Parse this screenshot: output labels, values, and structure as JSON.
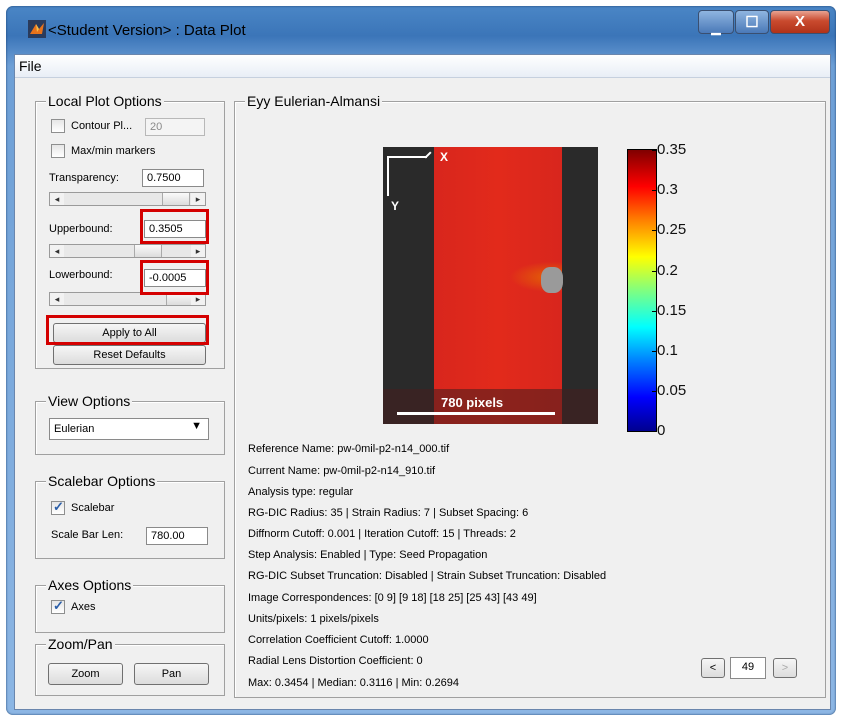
{
  "window": {
    "title": "<Student Version> : Data Plot"
  },
  "menu": {
    "file": "File"
  },
  "local_plot": {
    "title": "Local Plot Options",
    "contour_label": "Contour Pl...",
    "contour_value": "20",
    "maxmin_label": "Max/min markers",
    "transparency_label": "Transparency:",
    "transparency_value": "0.7500",
    "upperbound_label": "Upperbound:",
    "upperbound_value": "0.3505",
    "lowerbound_label": "Lowerbound:",
    "lowerbound_value": "-0.0005",
    "apply_all": "Apply to All",
    "reset": "Reset Defaults"
  },
  "view_options": {
    "title": "View Options",
    "selected": "Eulerian"
  },
  "scalebar_options": {
    "title": "Scalebar Options",
    "scalebar_label": "Scalebar",
    "scalebar_checked": true,
    "len_label": "Scale Bar Len:",
    "len_value": "780.00"
  },
  "axes_options": {
    "title": "Axes Options",
    "axes_label": "Axes",
    "axes_checked": true
  },
  "zoom_pan": {
    "title": "Zoom/Pan",
    "zoom": "Zoom",
    "pan": "Pan"
  },
  "plot": {
    "title": "Eyy Eulerian-Almansi",
    "scalebar_text": "780 pixels",
    "axis_x": "X",
    "axis_y": "Y",
    "colorbar_ticks": [
      "0.35",
      "0.3",
      "0.25",
      "0.2",
      "0.15",
      "0.1",
      "0.05",
      "0"
    ]
  },
  "info": [
    "Reference Name: pw-0mil-p2-n14_000.tif",
    "Current Name: pw-0mil-p2-n14_910.tif",
    "Analysis type: regular",
    "RG-DIC Radius: 35 | Strain Radius: 7 | Subset Spacing: 6",
    "Diffnorm Cutoff: 0.001 | Iteration Cutoff: 15 | Threads: 2",
    "Step Analysis: Enabled | Type: Seed Propagation",
    "RG-DIC Subset Truncation: Disabled | Strain Subset Truncation: Disabled",
    "Image Correspondences: [0 9] [9 18] [18 25] [25 43] [43 49]",
    "Units/pixels: 1 pixels/pixels",
    "Correlation Coefficient Cutoff: 1.0000",
    "Radial Lens Distortion Coefficient: 0",
    "Max: 0.3454 | Median: 0.3116 | Min: 0.2694"
  ],
  "nav": {
    "prev": "<",
    "page": "49",
    "next": ">"
  }
}
